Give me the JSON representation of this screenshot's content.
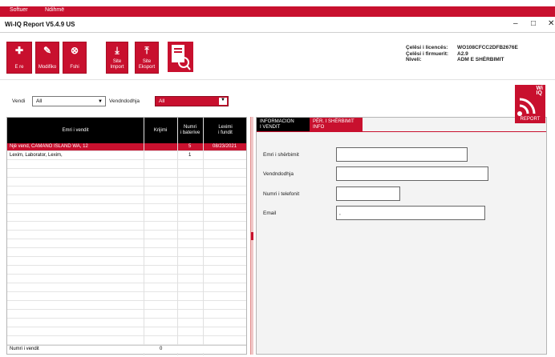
{
  "menu": {
    "items": [
      "Softuer",
      "Ndihmë"
    ]
  },
  "window": {
    "title": "Wi-IQ Report V5.4.9 US",
    "minimize": "–",
    "maximize": "□",
    "close": "✕"
  },
  "ribbon": {
    "buttons": [
      {
        "label": "E re",
        "icon": "new-file-icon"
      },
      {
        "label": "Modifiko",
        "icon": "edit-icon"
      },
      {
        "label": "Fshi",
        "icon": "delete-icon"
      },
      {
        "label": "Site\nImport",
        "icon": "import-icon"
      },
      {
        "label": "Site\nEksport",
        "icon": "export-icon"
      }
    ],
    "report_icon": "report-search-icon"
  },
  "license": {
    "labels": [
      "Çelësi i licencës:",
      "Çelësi i firmuerit:",
      "Niveli:"
    ],
    "values": [
      "WO108CFCC2DFB2676E",
      "A2.9",
      "ADM E SHËRBIMIT"
    ]
  },
  "filters": {
    "country_label": "Vendi",
    "country_value": "All",
    "location_label": "Vendndodhja",
    "location_value": "All"
  },
  "grid": {
    "columns": [
      "Emri i vendit",
      "Krijimi",
      "Numri\ni baterive",
      "Leximi\ni fundit"
    ],
    "rows": [
      {
        "name": "Një vend, CAMANO ISLAND WA, 12",
        "created": "",
        "batteries": "5",
        "last_read": "08/23/2021",
        "selected": true
      },
      {
        "name": "Lexim, Laborator, Lexim,",
        "created": "",
        "batteries": "1",
        "last_read": "",
        "selected": false
      }
    ],
    "footer_label": "Numri i vendit",
    "footer_value": "0"
  },
  "tabs": [
    {
      "label": "INFORMACION\nI VENDIT",
      "active": false
    },
    {
      "label": "PËR. I SHËRBIMIT\nINFO",
      "active": true
    }
  ],
  "form": {
    "service_name_label": "Emri i shërbimit",
    "location_label": "Vendndodhja",
    "phone_label": "Numri i telefonit",
    "email_label": "Email",
    "email_value": ","
  },
  "logo": {
    "top": "Wi\nIQ",
    "bottom": "REPORT"
  },
  "colors": {
    "accent": "#c8102e",
    "header": "#000000"
  }
}
